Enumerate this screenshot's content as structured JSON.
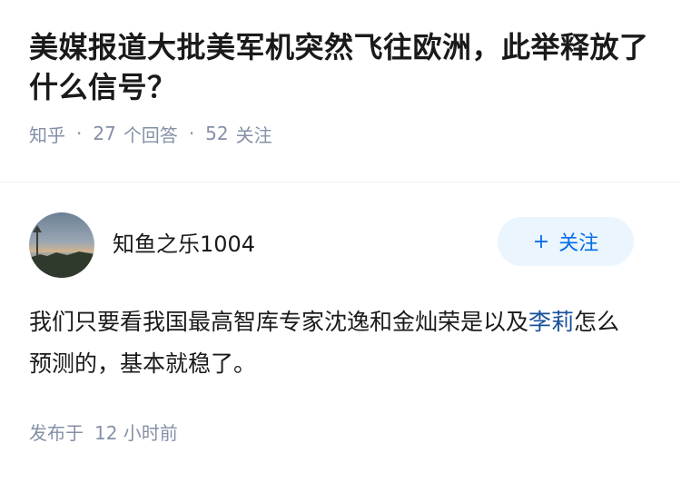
{
  "question": {
    "title": "美媒报道大批美军机突然飞往欧洲，此举释放了什么信号？",
    "source": "知乎",
    "answer_count": "27",
    "answer_label": "个回答",
    "follower_count": "52",
    "follower_label": "关注",
    "separator": "·"
  },
  "answer": {
    "author_name": "知鱼之乐1004",
    "follow_button": {
      "icon": "+",
      "label": "关注"
    },
    "content_before_link": "我们只要看我国最高智库专家沈逸和金灿荣是以及",
    "content_link": "李莉",
    "content_after_link": "怎么预测的，基本就稳了。",
    "time_prefix": "发布于",
    "time_value": "12 小时前"
  },
  "colors": {
    "accent": "#056de8",
    "meta_gray": "#8590a6",
    "link": "#175199",
    "button_bg": "#ebf5fd"
  }
}
